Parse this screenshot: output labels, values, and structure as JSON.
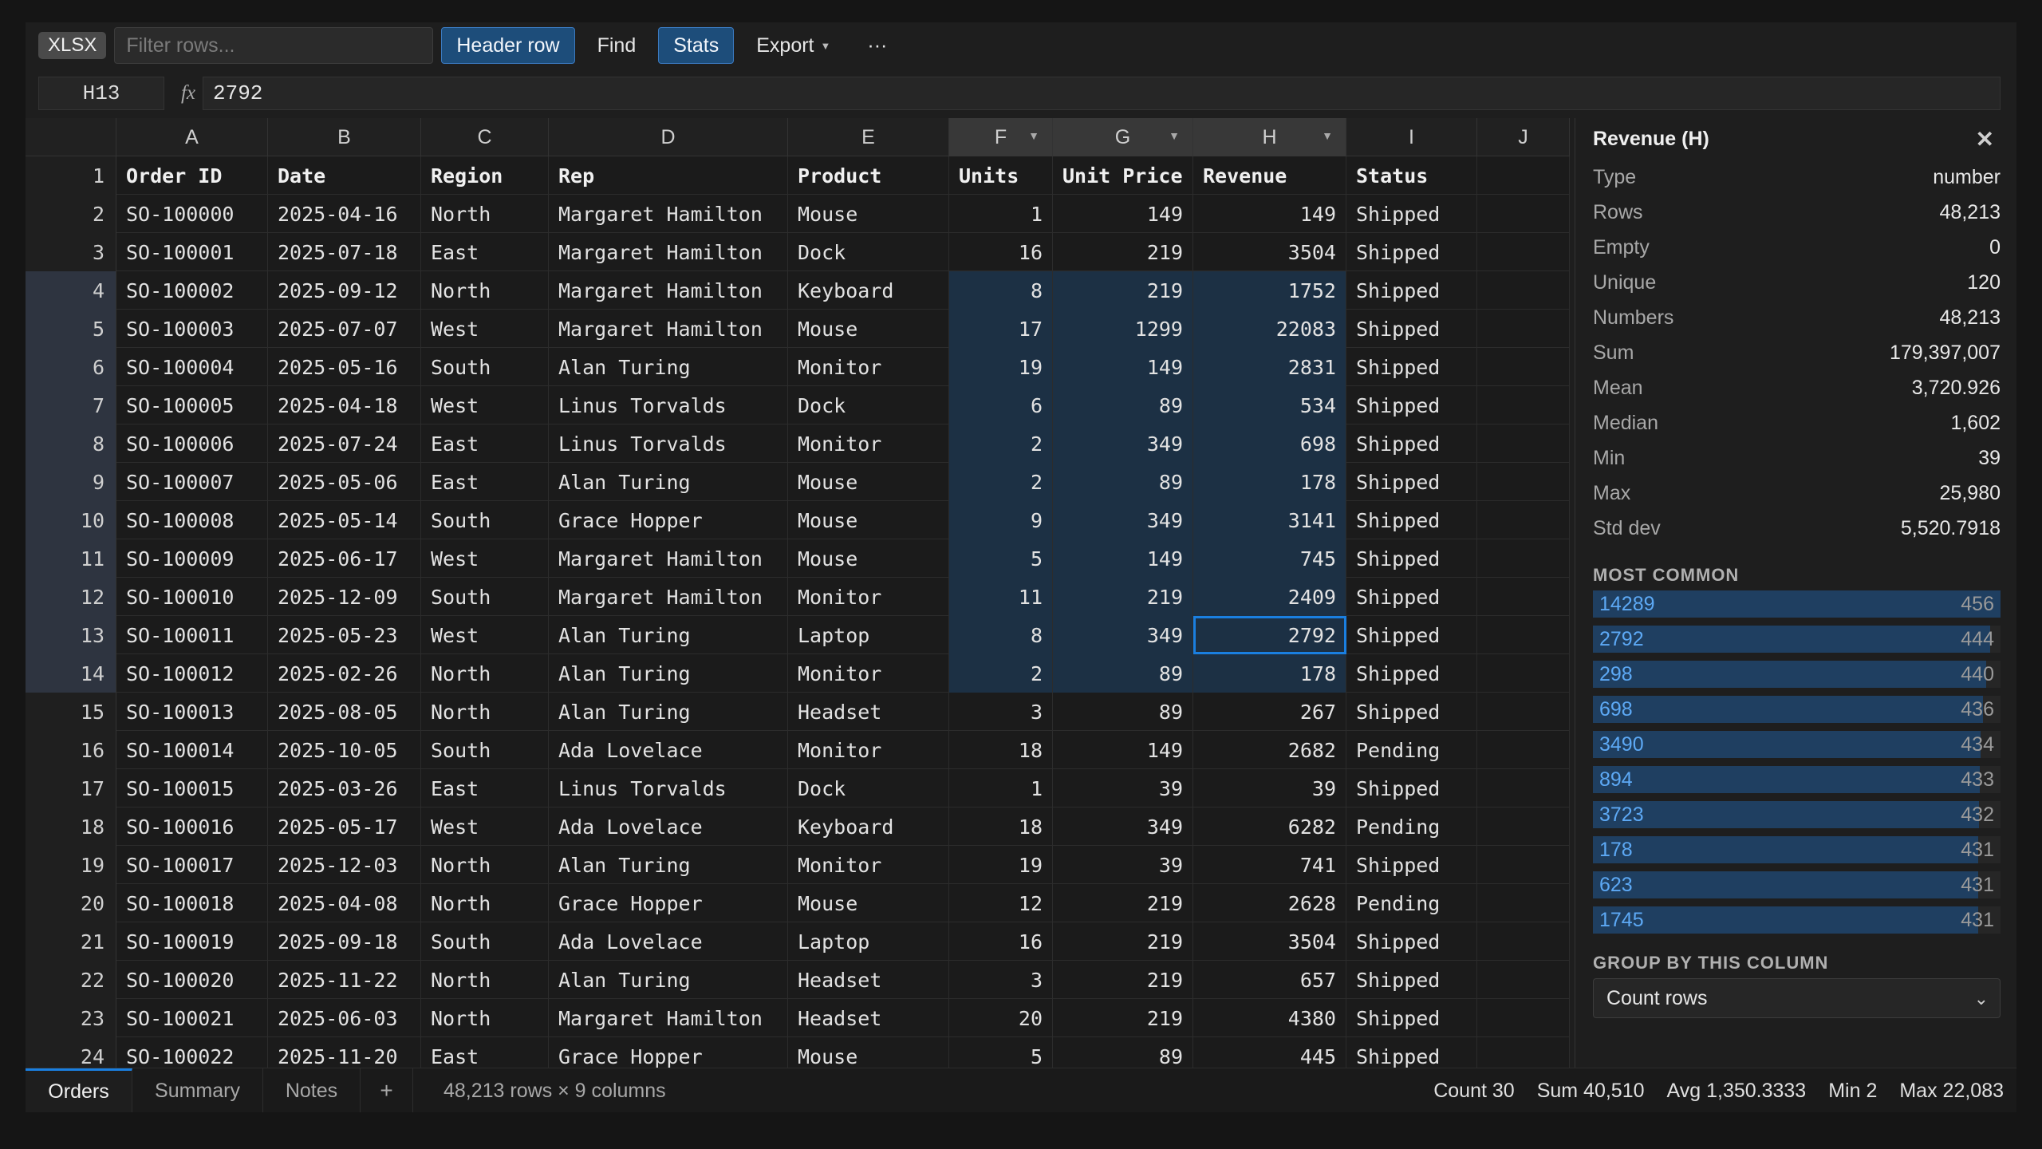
{
  "toolbar": {
    "format_badge": "XLSX",
    "filter_placeholder": "Filter rows...",
    "header_row_label": "Header row",
    "find_label": "Find",
    "stats_label": "Stats",
    "export_label": "Export",
    "more_label": "···"
  },
  "formula": {
    "cell_ref": "H13",
    "fx_label": "fx",
    "value": "2792"
  },
  "grid": {
    "column_letters": [
      "A",
      "B",
      "C",
      "D",
      "E",
      "F",
      "G",
      "H",
      "I",
      "J"
    ],
    "header_row_number": "1",
    "headers": [
      "Order ID",
      "Date",
      "Region",
      "Rep",
      "Product",
      "Units",
      "Unit Price",
      "Revenue",
      "Status"
    ],
    "rows": [
      {
        "n": "2",
        "c": [
          "SO-100000",
          "2025-04-16",
          "North",
          "Margaret Hamilton",
          "Mouse",
          "1",
          "149",
          "149",
          "Shipped"
        ]
      },
      {
        "n": "3",
        "c": [
          "SO-100001",
          "2025-07-18",
          "East",
          "Margaret Hamilton",
          "Dock",
          "16",
          "219",
          "3504",
          "Shipped"
        ]
      },
      {
        "n": "4",
        "c": [
          "SO-100002",
          "2025-09-12",
          "North",
          "Margaret Hamilton",
          "Keyboard",
          "8",
          "219",
          "1752",
          "Shipped"
        ]
      },
      {
        "n": "5",
        "c": [
          "SO-100003",
          "2025-07-07",
          "West",
          "Margaret Hamilton",
          "Mouse",
          "17",
          "1299",
          "22083",
          "Shipped"
        ]
      },
      {
        "n": "6",
        "c": [
          "SO-100004",
          "2025-05-16",
          "South",
          "Alan Turing",
          "Monitor",
          "19",
          "149",
          "2831",
          "Shipped"
        ]
      },
      {
        "n": "7",
        "c": [
          "SO-100005",
          "2025-04-18",
          "West",
          "Linus Torvalds",
          "Dock",
          "6",
          "89",
          "534",
          "Shipped"
        ]
      },
      {
        "n": "8",
        "c": [
          "SO-100006",
          "2025-07-24",
          "East",
          "Linus Torvalds",
          "Monitor",
          "2",
          "349",
          "698",
          "Shipped"
        ]
      },
      {
        "n": "9",
        "c": [
          "SO-100007",
          "2025-05-06",
          "East",
          "Alan Turing",
          "Mouse",
          "2",
          "89",
          "178",
          "Shipped"
        ]
      },
      {
        "n": "10",
        "c": [
          "SO-100008",
          "2025-05-14",
          "South",
          "Grace Hopper",
          "Mouse",
          "9",
          "349",
          "3141",
          "Shipped"
        ]
      },
      {
        "n": "11",
        "c": [
          "SO-100009",
          "2025-06-17",
          "West",
          "Margaret Hamilton",
          "Mouse",
          "5",
          "149",
          "745",
          "Shipped"
        ]
      },
      {
        "n": "12",
        "c": [
          "SO-100010",
          "2025-12-09",
          "South",
          "Margaret Hamilton",
          "Monitor",
          "11",
          "219",
          "2409",
          "Shipped"
        ]
      },
      {
        "n": "13",
        "c": [
          "SO-100011",
          "2025-05-23",
          "West",
          "Alan Turing",
          "Laptop",
          "8",
          "349",
          "2792",
          "Shipped"
        ]
      },
      {
        "n": "14",
        "c": [
          "SO-100012",
          "2025-02-26",
          "North",
          "Alan Turing",
          "Monitor",
          "2",
          "89",
          "178",
          "Shipped"
        ]
      },
      {
        "n": "15",
        "c": [
          "SO-100013",
          "2025-08-05",
          "North",
          "Alan Turing",
          "Headset",
          "3",
          "89",
          "267",
          "Shipped"
        ]
      },
      {
        "n": "16",
        "c": [
          "SO-100014",
          "2025-10-05",
          "South",
          "Ada Lovelace",
          "Monitor",
          "18",
          "149",
          "2682",
          "Pending"
        ]
      },
      {
        "n": "17",
        "c": [
          "SO-100015",
          "2025-03-26",
          "East",
          "Linus Torvalds",
          "Dock",
          "1",
          "39",
          "39",
          "Shipped"
        ]
      },
      {
        "n": "18",
        "c": [
          "SO-100016",
          "2025-05-17",
          "West",
          "Ada Lovelace",
          "Keyboard",
          "18",
          "349",
          "6282",
          "Pending"
        ]
      },
      {
        "n": "19",
        "c": [
          "SO-100017",
          "2025-12-03",
          "North",
          "Alan Turing",
          "Monitor",
          "19",
          "39",
          "741",
          "Shipped"
        ]
      },
      {
        "n": "20",
        "c": [
          "SO-100018",
          "2025-04-08",
          "North",
          "Grace Hopper",
          "Mouse",
          "12",
          "219",
          "2628",
          "Pending"
        ]
      },
      {
        "n": "21",
        "c": [
          "SO-100019",
          "2025-09-18",
          "South",
          "Ada Lovelace",
          "Laptop",
          "16",
          "219",
          "3504",
          "Shipped"
        ]
      },
      {
        "n": "22",
        "c": [
          "SO-100020",
          "2025-11-22",
          "North",
          "Alan Turing",
          "Headset",
          "3",
          "219",
          "657",
          "Shipped"
        ]
      },
      {
        "n": "23",
        "c": [
          "SO-100021",
          "2025-06-03",
          "North",
          "Margaret Hamilton",
          "Headset",
          "20",
          "219",
          "4380",
          "Shipped"
        ]
      },
      {
        "n": "24",
        "c": [
          "SO-100022",
          "2025-11-20",
          "East",
          "Grace Hopper",
          "Mouse",
          "5",
          "89",
          "445",
          "Shipped"
        ]
      }
    ]
  },
  "panel": {
    "title": "Revenue (H)",
    "close_label": "✕",
    "stats": [
      {
        "k": "Type",
        "v": "number"
      },
      {
        "k": "Rows",
        "v": "48,213"
      },
      {
        "k": "Empty",
        "v": "0"
      },
      {
        "k": "Unique",
        "v": "120"
      },
      {
        "k": "Numbers",
        "v": "48,213"
      },
      {
        "k": "Sum",
        "v": "179,397,007"
      },
      {
        "k": "Mean",
        "v": "3,720.926"
      },
      {
        "k": "Median",
        "v": "1,602"
      },
      {
        "k": "Min",
        "v": "39"
      },
      {
        "k": "Max",
        "v": "25,980"
      },
      {
        "k": "Std dev",
        "v": "5,520.7918"
      }
    ],
    "most_common_title": "MOST COMMON",
    "most_common": [
      {
        "value": "14289",
        "count": 456
      },
      {
        "value": "2792",
        "count": 444
      },
      {
        "value": "298",
        "count": 440
      },
      {
        "value": "698",
        "count": 436
      },
      {
        "value": "3490",
        "count": 434
      },
      {
        "value": "894",
        "count": 433
      },
      {
        "value": "3723",
        "count": 432
      },
      {
        "value": "178",
        "count": 431
      },
      {
        "value": "623",
        "count": 431
      },
      {
        "value": "1745",
        "count": 431
      }
    ],
    "group_title": "GROUP BY THIS COLUMN",
    "group_select": "Count rows"
  },
  "bottom": {
    "tabs": [
      "Orders",
      "Summary",
      "Notes"
    ],
    "add_tab": "+",
    "dims": "48,213 rows × 9 columns",
    "agg": {
      "count": "Count 30",
      "sum": "Sum 40,510",
      "avg": "Avg 1,350.3333",
      "min": "Min 2",
      "max": "Max 22,083"
    }
  },
  "colors": {
    "accent": "#1a7fe0",
    "range_fill": "#1c3044",
    "freq_bar": "#1f3f61",
    "freq_text": "#5da9f5"
  }
}
